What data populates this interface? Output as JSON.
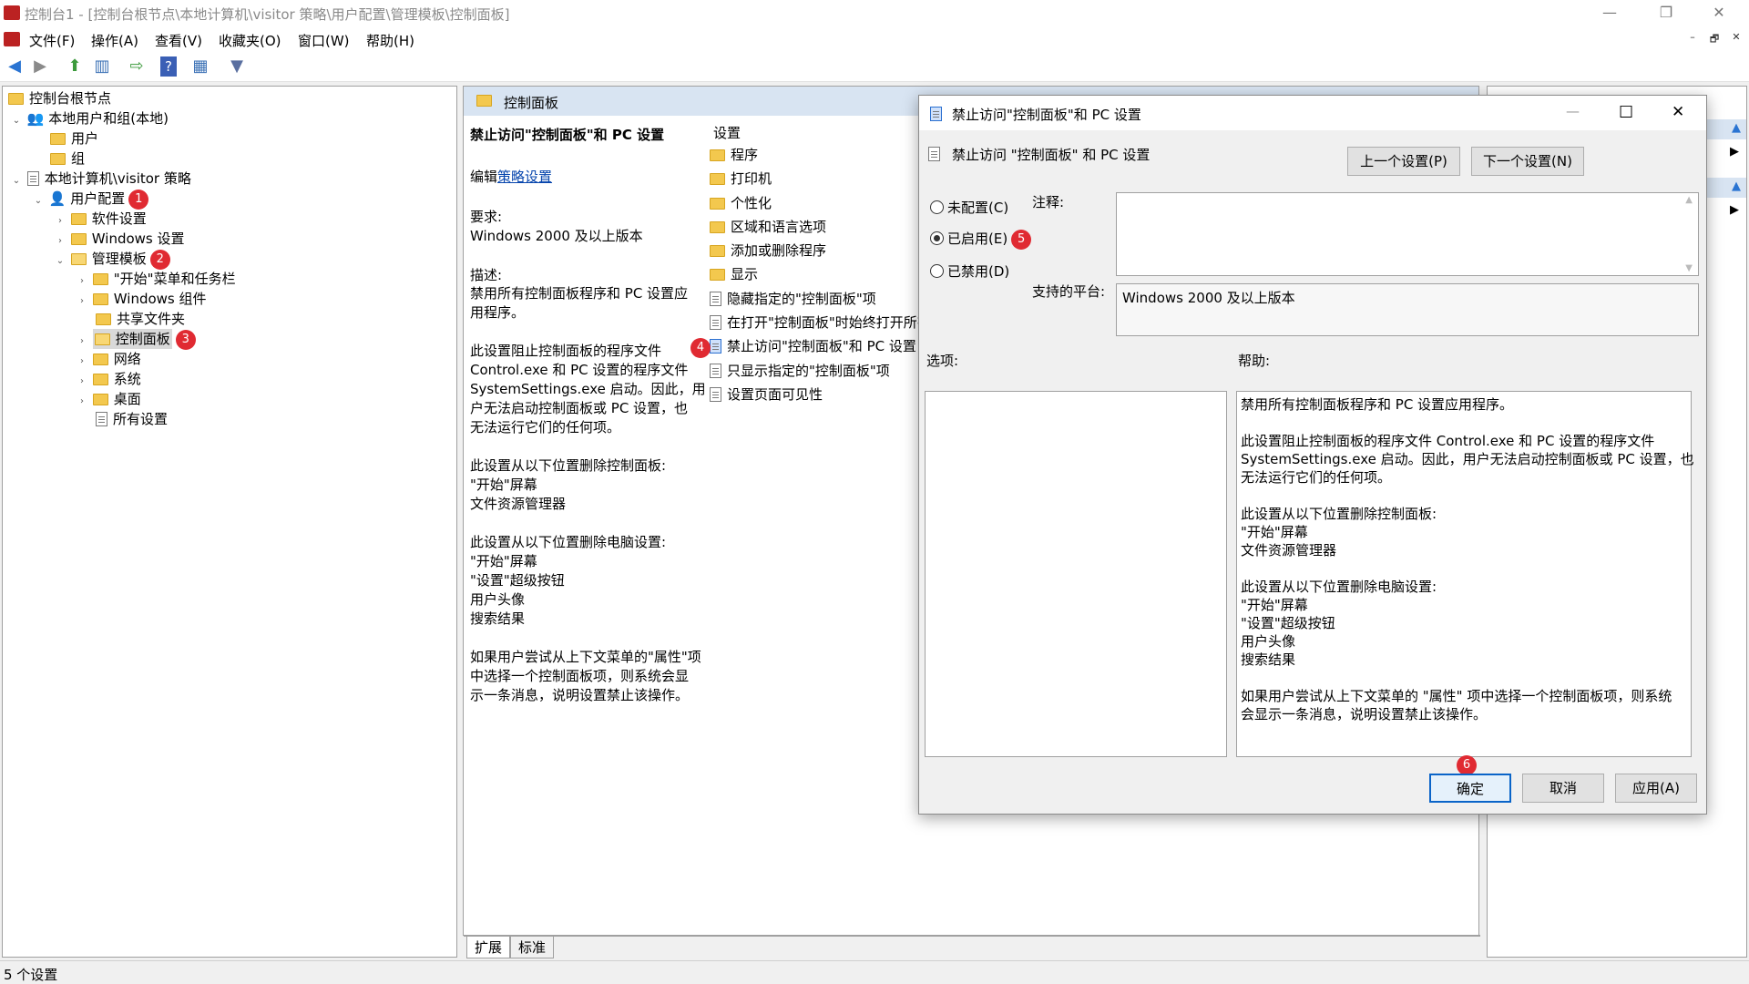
{
  "window": {
    "title": "控制台1 - [控制台根节点\\本地计算机\\visitor 策略\\用户配置\\管理模板\\控制面板]",
    "min": "—",
    "restore": "❐",
    "close": "✕"
  },
  "menubar": {
    "items": [
      "文件(F)",
      "操作(A)",
      "查看(V)",
      "收藏夹(O)",
      "窗口(W)",
      "帮助(H)"
    ],
    "mdi": [
      "–",
      "🗗",
      "✕"
    ]
  },
  "toolbar": {
    "icons": [
      "back-arrow-icon",
      "forward-arrow-icon",
      "up-folder-icon",
      "show-hide-tree-icon",
      "export-list-icon",
      "help-icon",
      "console-icon",
      "filter-icon"
    ]
  },
  "tree": {
    "root": "控制台根节点",
    "local_users": "本地用户和组(本地)",
    "users": "用户",
    "groups": "组",
    "local_policy": "本地计算机\\visitor 策略",
    "user_config": "用户配置",
    "software": "软件设置",
    "windows_settings": "Windows 设置",
    "admin_templates": "管理模板",
    "start_menu": "\"开始\"菜单和任务栏",
    "windows_components": "Windows 组件",
    "shared_folders": "共享文件夹",
    "control_panel": "控制面板",
    "network": "网络",
    "system": "系统",
    "desktop": "桌面",
    "all_settings": "所有设置"
  },
  "badges": {
    "b1": "1",
    "b2": "2",
    "b3": "3",
    "b4": "4",
    "b5": "5",
    "b6": "6"
  },
  "middle": {
    "header": "控制面板",
    "policy_title": "禁止访问\"控制面板\"和 PC 设置",
    "edit_prefix": "编辑",
    "edit_link": "策略设置",
    "req_label": "要求:",
    "req_value": "Windows 2000 及以上版本",
    "desc_label": "描述:",
    "desc_lines": [
      "禁用所有控制面板程序和 PC 设置应",
      "用程序。",
      "",
      "此设置阻止控制面板的程序文件",
      "Control.exe 和 PC 设置的程序文件",
      "SystemSettings.exe 启动。因此，用",
      "户无法启动控制面板或 PC 设置，也",
      "无法运行它们的任何项。",
      "",
      "此设置从以下位置删除控制面板:",
      "\"开始\"屏幕",
      "文件资源管理器",
      "",
      "此设置从以下位置删除电脑设置:",
      "\"开始\"屏幕",
      "\"设置\"超级按钮",
      "用户头像",
      "搜索结果",
      "",
      "如果用户尝试从上下文菜单的\"属性\"项",
      "中选择一个控制面板项，则系统会显",
      "示一条消息，说明设置禁止该操作。"
    ],
    "list_header": "设置",
    "folders": [
      "程序",
      "打印机",
      "个性化",
      "区域和语言选项",
      "添加或删除程序",
      "显示"
    ],
    "settings": [
      "隐藏指定的\"控制面板\"项",
      "在打开\"控制面板\"时始终打开所有",
      "禁止访问\"控制面板\"和 PC 设置",
      "只显示指定的\"控制面板\"项",
      "设置页面可见性"
    ],
    "tabs": [
      "扩展",
      "标准"
    ]
  },
  "dialog": {
    "title": "禁止访问\"控制面板\"和 PC 设置",
    "min": "—",
    "max": "☐",
    "close": "✕",
    "header": "禁止访问 \"控制面板\" 和 PC 设置",
    "prev": "上一个设置(P)",
    "next": "下一个设置(N)",
    "not_configured": "未配置(C)",
    "enabled": "已启用(E)",
    "disabled": "已禁用(D)",
    "comment_label": "注释:",
    "platform_label": "支持的平台:",
    "platform_value": "Windows 2000 及以上版本",
    "options_label": "选项:",
    "help_label": "帮助:",
    "help_lines": [
      "禁用所有控制面板程序和 PC 设置应用程序。",
      "",
      "此设置阻止控制面板的程序文件 Control.exe 和 PC 设置的程序文件",
      "SystemSettings.exe 启动。因此，用户无法启动控制面板或 PC 设置，也",
      "无法运行它们的任何项。",
      "",
      "此设置从以下位置删除控制面板:",
      "\"开始\"屏幕",
      "文件资源管理器",
      "",
      "此设置从以下位置删除电脑设置:",
      "\"开始\"屏幕",
      "\"设置\"超级按钮",
      "用户头像",
      "搜索结果",
      "",
      "如果用户尝试从上下文菜单的 \"属性\" 项中选择一个控制面板项，则系统",
      "会显示一条消息，说明设置禁止该操作。"
    ],
    "ok": "确定",
    "cancel": "取消",
    "apply": "应用(A)"
  },
  "status": {
    "text": "5 个设置"
  }
}
